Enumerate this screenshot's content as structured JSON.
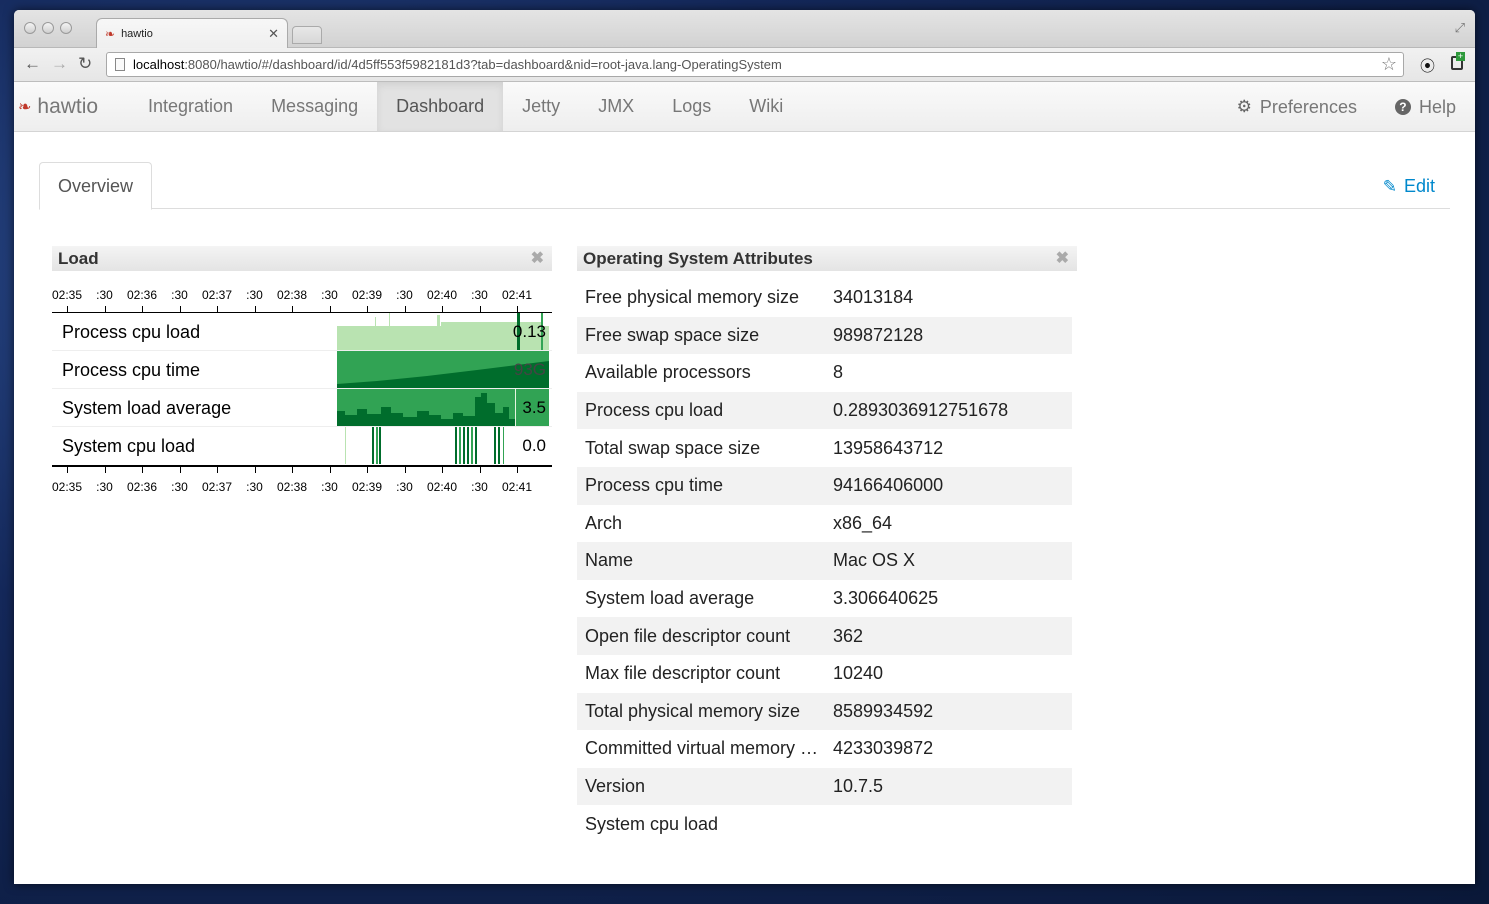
{
  "browser": {
    "tab_title": "hawtio",
    "url_host": "localhost",
    "url_rest": ":8080/hawtio/#/dashboard/id/4d5ff553f5982181d3?tab=dashboard&nid=root-java.lang-OperatingSystem"
  },
  "app": {
    "brand": "hawtio",
    "nav": [
      "Integration",
      "Messaging",
      "Dashboard",
      "Jetty",
      "JMX",
      "Logs",
      "Wiki"
    ],
    "active_nav": "Dashboard",
    "preferences_label": "Preferences",
    "help_label": "Help"
  },
  "subtabs": {
    "overview_label": "Overview",
    "edit_label": "Edit"
  },
  "load_widget": {
    "title": "Load",
    "time_ticks": [
      "02:35",
      ":30",
      "02:36",
      ":30",
      "02:37",
      ":30",
      "02:38",
      ":30",
      "02:39",
      ":30",
      "02:40",
      ":30",
      "02:41"
    ],
    "rows": [
      {
        "name": "Process cpu load",
        "value": "0.13"
      },
      {
        "name": "Process cpu time",
        "value": "93G"
      },
      {
        "name": "System load average",
        "value": "3.5"
      },
      {
        "name": "System cpu load",
        "value": "0.0"
      }
    ]
  },
  "os_widget": {
    "title": "Operating System Attributes",
    "attributes": [
      {
        "key": "Free physical memory size",
        "value": "34013184"
      },
      {
        "key": "Free swap space size",
        "value": "989872128"
      },
      {
        "key": "Available processors",
        "value": "8"
      },
      {
        "key": "Process cpu load",
        "value": "0.2893036912751678"
      },
      {
        "key": "Total swap space size",
        "value": "13958643712"
      },
      {
        "key": "Process cpu time",
        "value": "94166406000"
      },
      {
        "key": "Arch",
        "value": "x86_64"
      },
      {
        "key": "Name",
        "value": "Mac OS X"
      },
      {
        "key": "System load average",
        "value": "3.306640625"
      },
      {
        "key": "Open file descriptor count",
        "value": "362"
      },
      {
        "key": "Max file descriptor count",
        "value": "10240"
      },
      {
        "key": "Total physical memory size",
        "value": "8589934592"
      },
      {
        "key": "Committed virtual memory size",
        "value": "4233039872"
      },
      {
        "key": "Version",
        "value": "10.7.5"
      },
      {
        "key": "System cpu load",
        "value": ""
      }
    ]
  },
  "colors": {
    "light_green": "#b9e3b1",
    "mid_green": "#31a354",
    "dark_green": "#006d2c",
    "link_blue": "#0088cc"
  }
}
